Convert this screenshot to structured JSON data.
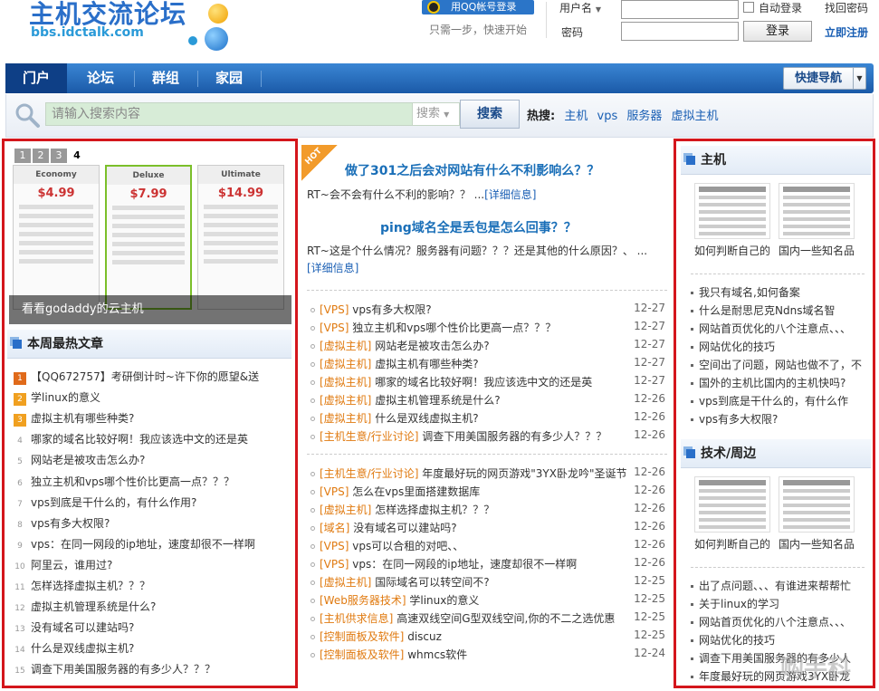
{
  "header": {
    "logo_cn": "主机交流论坛",
    "logo_url": "bbs.idctalk.com",
    "qq_login": "用QQ帐号登录",
    "qq_tip": "只需一步，快速开始",
    "username_label": "用户名",
    "password_label": "密码",
    "auto_login": "自动登录",
    "find_password": "找回密码",
    "login": "登录",
    "register": "立即注册"
  },
  "nav": {
    "items": [
      "门户",
      "论坛",
      "群组",
      "家园"
    ],
    "quick": "快捷导航"
  },
  "search": {
    "placeholder": "请输入搜索内容",
    "scope": "搜索",
    "button": "搜索",
    "hot_label": "热搜:",
    "hot_terms": [
      "主机",
      "vps",
      "服务器",
      "虚拟主机"
    ]
  },
  "slide": {
    "caption": "看看godaddy的云主机",
    "nums": [
      "1",
      "2",
      "3",
      "4"
    ],
    "plans": [
      {
        "name": "Economy",
        "price": "$4.99"
      },
      {
        "name": "Deluxe",
        "price": "$7.99"
      },
      {
        "name": "Ultimate",
        "price": "$14.99"
      }
    ]
  },
  "weekly": {
    "title": "本周最热文章",
    "items": [
      {
        "n": "1",
        "t": "【QQ672757】考研倒计时~许下你的愿望&送"
      },
      {
        "n": "2",
        "t": "学linux的意义"
      },
      {
        "n": "3",
        "t": "虚拟主机有哪些种类?"
      },
      {
        "n": "4",
        "t": "哪家的域名比较好啊！我应该选中文的还是英"
      },
      {
        "n": "5",
        "t": "网站老是被攻击怎么办?"
      },
      {
        "n": "6",
        "t": "独立主机和vps哪个性价比更高一点？？？"
      },
      {
        "n": "7",
        "t": "vps到底是干什么的，有什么作用?"
      },
      {
        "n": "8",
        "t": "vps有多大权限?"
      },
      {
        "n": "9",
        "t": "vps：在同一网段的ip地址，速度却很不一样啊"
      },
      {
        "n": "10",
        "t": "阿里云，谁用过?"
      },
      {
        "n": "11",
        "t": "怎样选择虚拟主机？？？"
      },
      {
        "n": "12",
        "t": "虚拟主机管理系统是什么?"
      },
      {
        "n": "13",
        "t": "没有域名可以建站吗?"
      },
      {
        "n": "14",
        "t": "什么是双线虚拟主机?"
      },
      {
        "n": "15",
        "t": "调查下用美国服务器的有多少人？？？"
      }
    ]
  },
  "featured": {
    "badge": "HOT",
    "items": [
      {
        "title": "做了301之后会对网站有什么不利影响么？？",
        "desc": "RT~会不会有什么不利的影响？？ ...",
        "more": "[详细信息]"
      },
      {
        "title": "ping域名全是丢包是怎么回事？？",
        "desc": "RT~这是个什么情况？服务器有问题？？？还是其他的什么原因？、 ...",
        "more": "[详细信息]"
      }
    ]
  },
  "list1": [
    {
      "cat": "[VPS]",
      "t": "vps有多大权限?",
      "d": "12-27"
    },
    {
      "cat": "[VPS]",
      "t": "独立主机和vps哪个性价比更高一点？？？",
      "d": "12-27"
    },
    {
      "cat": "[虚拟主机]",
      "t": "网站老是被攻击怎么办?",
      "d": "12-27"
    },
    {
      "cat": "[虚拟主机]",
      "t": "虚拟主机有哪些种类?",
      "d": "12-27"
    },
    {
      "cat": "[虚拟主机]",
      "t": "哪家的域名比较好啊！我应该选中文的还是英",
      "d": "12-27"
    },
    {
      "cat": "[虚拟主机]",
      "t": "虚拟主机管理系统是什么?",
      "d": "12-26"
    },
    {
      "cat": "[虚拟主机]",
      "t": "什么是双线虚拟主机?",
      "d": "12-26"
    },
    {
      "cat": "[主机生意/行业讨论]",
      "t": "调查下用美国服务器的有多少人？？？",
      "d": "12-26"
    }
  ],
  "list2": [
    {
      "cat": "[主机生意/行业讨论]",
      "t": "年度最好玩的网页游戏\"3YX卧龙吟\"圣诞节",
      "d": "12-26"
    },
    {
      "cat": "[VPS]",
      "t": "怎么在vps里面搭建数据库",
      "d": "12-26"
    },
    {
      "cat": "[虚拟主机]",
      "t": "怎样选择虚拟主机？？？",
      "d": "12-26"
    },
    {
      "cat": "[域名]",
      "t": "没有域名可以建站吗?",
      "d": "12-26"
    },
    {
      "cat": "[VPS]",
      "t": "vps可以合租的对吧、、",
      "d": "12-26"
    },
    {
      "cat": "[VPS]",
      "t": "vps：在同一网段的ip地址，速度却很不一样啊",
      "d": "12-26"
    },
    {
      "cat": "[虚拟主机]",
      "t": "国际域名可以转空间不?",
      "d": "12-25"
    },
    {
      "cat": "[Web服务器技术]",
      "t": "学linux的意义",
      "d": "12-25"
    },
    {
      "cat": "[主机供求信息]",
      "t": "高速双线空间G型双线空间,你的不二之选优惠",
      "d": "12-25"
    },
    {
      "cat": "[控制面板及软件]",
      "t": "discuz",
      "d": "12-25"
    },
    {
      "cat": "[控制面板及软件]",
      "t": "whmcs软件",
      "d": "12-24"
    }
  ],
  "right1": {
    "title": "主机",
    "thumbs": [
      "如何判断自己的",
      "国内一些知名品"
    ],
    "items": [
      "我只有域名,如何备案",
      "什么是耐思尼克Ndns域名智",
      "网站首页优化的八个注意点、、、",
      "网站优化的技巧",
      "空间出了问题，网站也做不了，不",
      "国外的主机比国内的主机快吗?",
      "vps到底是干什么的，有什么作",
      "vps有多大权限?"
    ]
  },
  "right2": {
    "title": "技术/周边",
    "thumbs": [
      "如何判断自己的",
      "国内一些知名品"
    ],
    "items": [
      "出了点问题、、、有谁进来帮帮忙",
      "关于linux的学习",
      "网站首页优化的八个注意点、、、",
      "网站优化的技巧",
      "调查下用美国服务器的有多少人",
      "年度最好玩的网页游戏3YX卧龙"
    ]
  },
  "watermark": "购手科"
}
